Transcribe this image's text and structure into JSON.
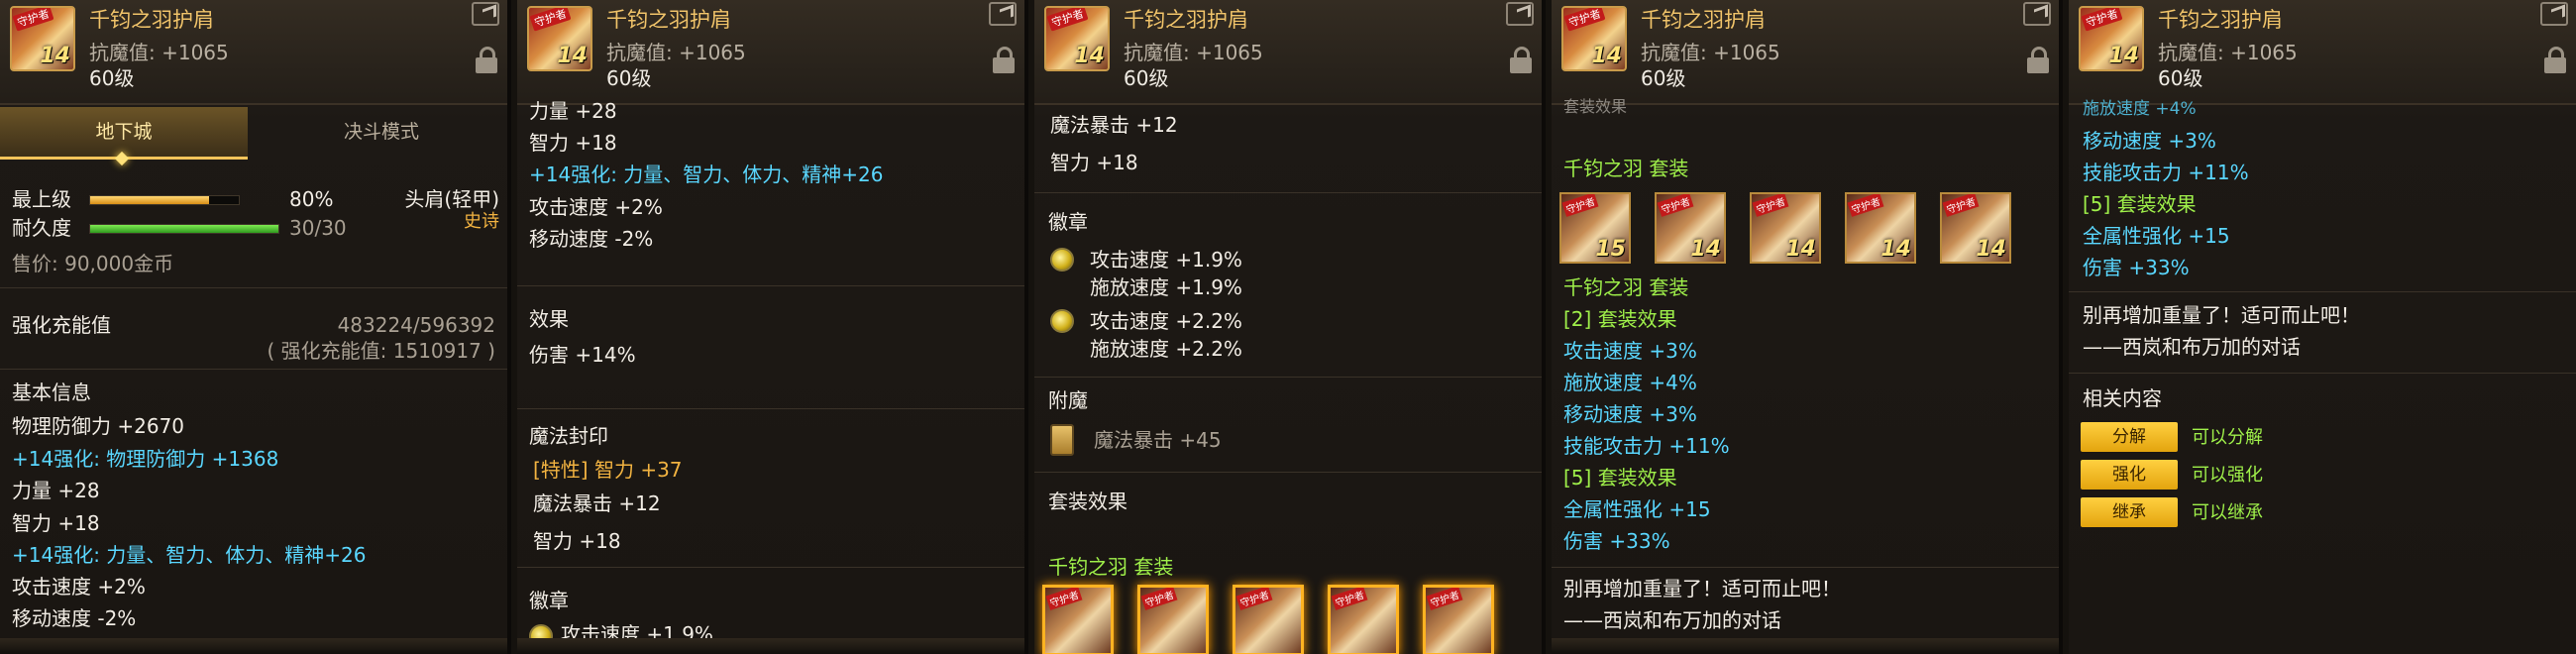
{
  "item": {
    "name": "千钧之羽护肩",
    "magic_resist": "抗魔值: +1065",
    "level": "60级",
    "icon_level": "14",
    "icon_tag": "守护者"
  },
  "panel1": {
    "tabs": [
      {
        "label": "地下城",
        "active": true
      },
      {
        "label": "决斗模式",
        "active": false
      }
    ],
    "upgrade_label": "最上级",
    "upgrade_pct": "80%",
    "upgrade_fraction": 0.8,
    "durability_label": "耐久度",
    "durability_value": "30/30",
    "durability_fraction": 1.0,
    "slot": "头肩(轻甲)",
    "rarity": "史诗",
    "price": "售价: 90,000金币",
    "amp_label": "强化充能值",
    "amp_value": "483224/596392",
    "amp_detail": "( 强化充能值: 1510917 )",
    "basic_info_title": "基本信息",
    "stats": [
      {
        "text": "物理防御力 +2670",
        "color": "white"
      },
      {
        "text": "+14强化: 物理防御力 +1368",
        "color": "cyan"
      },
      {
        "text": "力量 +28",
        "color": "white"
      },
      {
        "text": "智力 +18",
        "color": "white"
      },
      {
        "text": "+14强化: 力量、智力、体力、精神+26",
        "color": "cyan"
      },
      {
        "text": "攻击速度 +2%",
        "color": "white"
      },
      {
        "text": "移动速度 -2%",
        "color": "white"
      }
    ]
  },
  "panel2": {
    "top_lines": [
      {
        "text": "力量 +28",
        "color": "white"
      },
      {
        "text": "智力 +18",
        "color": "white"
      },
      {
        "text": "+14强化: 力量、智力、体力、精神+26",
        "color": "cyan"
      },
      {
        "text": "攻击速度 +2%",
        "color": "white"
      },
      {
        "text": "移动速度 -2%",
        "color": "white"
      }
    ],
    "effect_title": "效果",
    "effect_line": "伤害 +14%",
    "seal_title": "魔法封印",
    "seal_lines": [
      "[特性] 智力 +37",
      "魔法暴击 +12",
      "智力 +18"
    ],
    "emblem_title": "徽章",
    "emblem_partial": "攻击速度 +1.9%"
  },
  "panel3": {
    "top_lines": [
      "魔法暴击 +12",
      "智力 +18"
    ],
    "emblem_title": "徽章",
    "emblems": [
      [
        "攻击速度 +1.9%",
        "施放速度 +1.9%"
      ],
      [
        "攻击速度 +2.2%",
        "施放速度 +2.2%"
      ]
    ],
    "enchant_title": "附魔",
    "enchant_line": "魔法暴击 +45",
    "set_effect_title": "套装效果",
    "set_name": "千钧之羽 套装",
    "set_icon_levels": [
      "",
      "",
      "",
      "",
      ""
    ]
  },
  "panel4": {
    "partial_top": "套装效果",
    "set_name": "千钧之羽 套装",
    "set_icon_levels": [
      "15",
      "14",
      "14",
      "14",
      "14"
    ],
    "set_name2": "千钧之羽 套装",
    "lines": [
      {
        "text": "[2] 套装效果",
        "color": "green"
      },
      {
        "text": "攻击速度 +3%",
        "color": "cyan"
      },
      {
        "text": "施放速度 +4%",
        "color": "cyan"
      },
      {
        "text": "移动速度 +3%",
        "color": "cyan"
      },
      {
        "text": "技能攻击力 +11%",
        "color": "cyan"
      },
      {
        "text": "[5] 套装效果",
        "color": "green"
      },
      {
        "text": "全属性强化 +15",
        "color": "cyan"
      },
      {
        "text": "伤害 +33%",
        "color": "cyan"
      }
    ],
    "flavor1": "别再增加重量了！适可而止吧！",
    "flavor2": "——西岚和布万加的对话"
  },
  "panel5": {
    "lines": [
      {
        "text": "施放速度 +4%",
        "color": "cyan"
      },
      {
        "text": "移动速度 +3%",
        "color": "cyan"
      },
      {
        "text": "技能攻击力 +11%",
        "color": "cyan"
      },
      {
        "text": "[5] 套装效果",
        "color": "green"
      },
      {
        "text": "全属性强化 +15",
        "color": "cyan"
      },
      {
        "text": "伤害 +33%",
        "color": "cyan"
      }
    ],
    "flavor1": "别再增加重量了！适可而止吧！",
    "flavor2": "——西岚和布万加的对话",
    "related_title": "相关内容",
    "actions": [
      {
        "button": "分解",
        "note": "可以分解"
      },
      {
        "button": "强化",
        "note": "可以强化"
      },
      {
        "button": "继承",
        "note": "可以继承"
      }
    ]
  }
}
